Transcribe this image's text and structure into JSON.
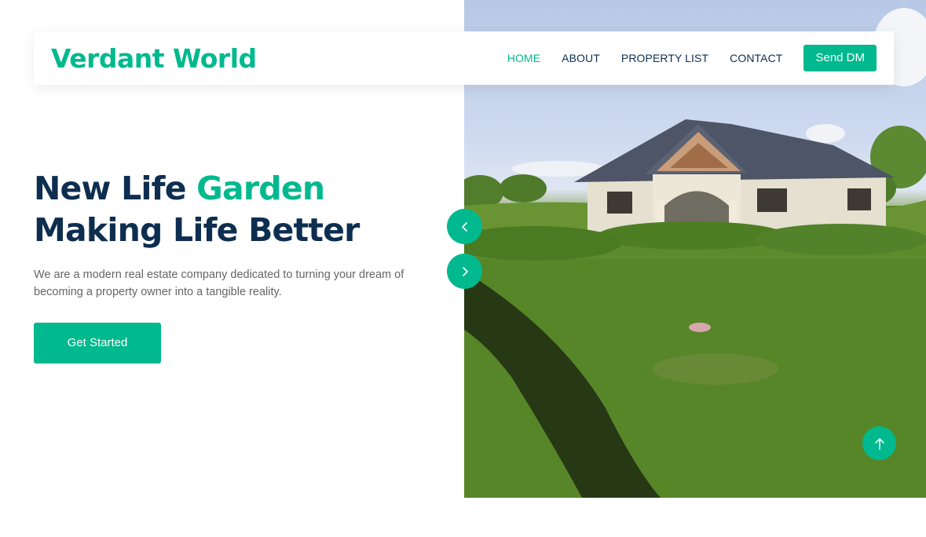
{
  "brand": {
    "name": "Verdant World",
    "color": "#00b98e"
  },
  "nav": {
    "items": [
      {
        "label": "HOME",
        "active": true
      },
      {
        "label": "ABOUT",
        "active": false
      },
      {
        "label": "PROPERTY LIST",
        "active": false
      },
      {
        "label": "CONTACT",
        "active": false
      }
    ],
    "cta_label": "Send DM"
  },
  "hero": {
    "title_part1": "New Life ",
    "title_accent": "Garden",
    "title_line2": "Making Life Better",
    "description": "We are a modern real estate company dedicated to turning your dream of becoming a property owner into a tangible reality.",
    "button_label": "Get Started"
  },
  "carousel": {
    "prev_icon": "chevron-left-icon",
    "next_icon": "chevron-right-icon"
  },
  "back_to_top": {
    "icon": "arrow-up-icon"
  },
  "colors": {
    "primary": "#00b98e",
    "heading": "#0e2e50",
    "text": "#666565"
  }
}
